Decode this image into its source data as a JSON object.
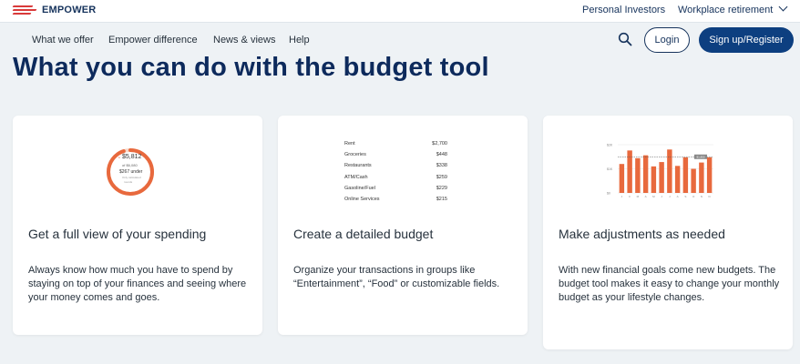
{
  "brand": {
    "name": "EMPOWER",
    "accent": "#d93a3a",
    "navy": "#0d2a5c"
  },
  "topbar": {
    "links": [
      "Personal Investors",
      "Workplace retirement"
    ]
  },
  "nav": {
    "items": [
      "What we offer",
      "Empower difference",
      "News & views",
      "Help"
    ],
    "search_icon": "search-icon",
    "login_label": "Login",
    "signup_label": "Sign up/Register"
  },
  "page": {
    "heading": "What you can do with the budget tool"
  },
  "cards": [
    {
      "title": "Get a full view of your spending",
      "text": "Always know how much you have to spend by staying on top of your finances and seeing where your money comes and goes.",
      "graphic": {
        "amount": "$5,812",
        "amount_sub": "of $6,080",
        "under": "$267 under",
        "note": "Only calculated",
        "note2": "rounds",
        "progress": 0.95
      }
    },
    {
      "title": "Create a detailed budget",
      "text": "Organize your transactions in groups like “Entertainment”, “Food” or customizable fields.",
      "graphic": {
        "rows": [
          {
            "category": "Rent",
            "amount": "$2,700"
          },
          {
            "category": "Groceries",
            "amount": "$448"
          },
          {
            "category": "Restaurants",
            "amount": "$338"
          },
          {
            "category": "ATM/Cash",
            "amount": "$259"
          },
          {
            "category": "Gasoline/Fuel",
            "amount": "$229"
          },
          {
            "category": "Online Services",
            "amount": "$215"
          }
        ]
      }
    },
    {
      "title": "Make adjustments as needed",
      "text": "With new financial goals come new budgets. The budget tool makes it easy to change your monthly budget as your lifestyle changes.",
      "graphic": {
        "ytick_labels": [
          "$2K",
          "$1K",
          "$0"
        ],
        "x_labels": [
          "J",
          "F",
          "M",
          "A",
          "M",
          "J",
          "J",
          "A",
          "S",
          "O",
          "N",
          "D"
        ],
        "values": [
          0.6,
          0.88,
          0.72,
          0.78,
          0.55,
          0.64,
          0.9,
          0.56,
          0.74,
          0.5,
          0.63,
          0.74
        ],
        "bar_color": "#e8693d",
        "line_label": "$1,850"
      }
    }
  ]
}
